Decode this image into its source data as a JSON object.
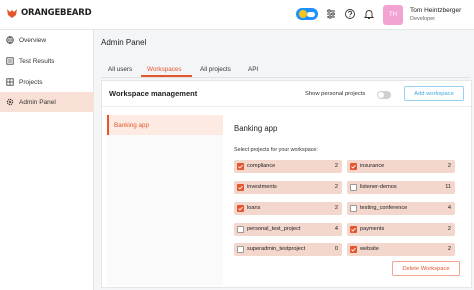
{
  "brand": {
    "name": "ORANGEBEARD"
  },
  "user": {
    "initials": "TH",
    "name": "Tom Heintzberger",
    "role": "Developer"
  },
  "topbar_icons": [
    "theme-toggle-icon",
    "sliders-icon",
    "help-icon",
    "bell-icon"
  ],
  "sidebar": {
    "items": [
      {
        "label": "Overview",
        "icon": "globe-icon",
        "active": false
      },
      {
        "label": "Test Results",
        "icon": "list-icon",
        "active": false
      },
      {
        "label": "Projects",
        "icon": "grid-icon",
        "active": false
      },
      {
        "label": "Admin Panel",
        "icon": "gear-icon",
        "active": true
      }
    ]
  },
  "page": {
    "title": "Admin Panel"
  },
  "tabs": [
    {
      "label": "All users",
      "active": false
    },
    {
      "label": "Workspaces",
      "active": true
    },
    {
      "label": "All projects",
      "active": false
    },
    {
      "label": "API",
      "active": false
    }
  ],
  "workspace_management": {
    "title": "Workspace management",
    "personal_label": "Show personal projects",
    "personal_on": false,
    "add_label": "Add workspace"
  },
  "workspaces": [
    {
      "label": "Banking app",
      "selected": true
    }
  ],
  "detail": {
    "title": "Banking app",
    "subtitle": "Select projects for your workspace:",
    "projects": [
      {
        "name": "compliance",
        "count": "2",
        "checked": true
      },
      {
        "name": "insurance",
        "count": "2",
        "checked": true
      },
      {
        "name": "investments",
        "count": "2",
        "checked": true
      },
      {
        "name": "listener-demos",
        "count": "11",
        "checked": false
      },
      {
        "name": "loans",
        "count": "2",
        "checked": true
      },
      {
        "name": "testing_conference",
        "count": "4",
        "checked": false
      },
      {
        "name": "personal_test_project",
        "count": "4",
        "checked": false
      },
      {
        "name": "payments",
        "count": "2",
        "checked": true
      },
      {
        "name": "superadmin_testproject",
        "count": "0",
        "checked": false
      },
      {
        "name": "website",
        "count": "2",
        "checked": true
      }
    ],
    "delete_label": "Delete Workspace"
  },
  "colors": {
    "accent": "#e4572e",
    "selected_row": "#f3d6cc",
    "add_button": "#3fa9e0"
  }
}
